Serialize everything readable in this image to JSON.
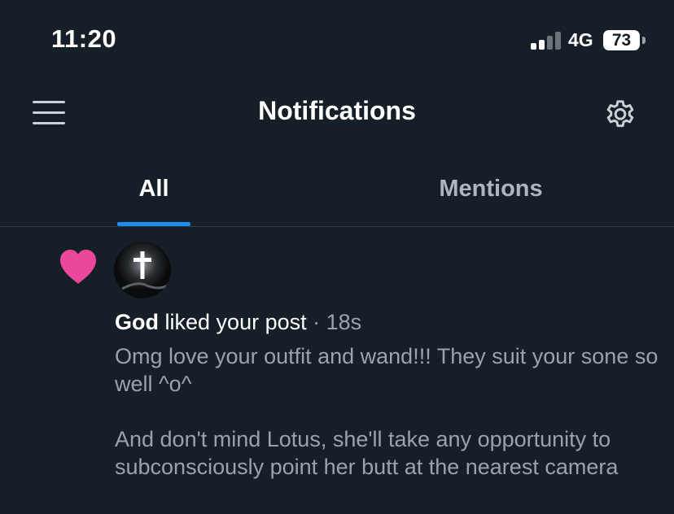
{
  "status_bar": {
    "time": "11:20",
    "network": "4G",
    "battery": "73"
  },
  "header": {
    "title": "Notifications"
  },
  "tabs": [
    {
      "label": "All",
      "active": true
    },
    {
      "label": "Mentions",
      "active": false
    }
  ],
  "colors": {
    "background": "#161e27",
    "accent": "#1d8cf0",
    "like": "#ec4899",
    "muted_text": "#9aa3ad"
  },
  "notifications": [
    {
      "type_icon": "heart-icon",
      "author": "God",
      "action": "liked your post",
      "separator": "·",
      "time": "18s",
      "avatar_icon": "cross-icon",
      "body_paragraphs": [
        "Omg love your outfit and wand!!! They suit your sone so well ^o^",
        "And don't mind Lotus, she'll take any opportunity to subconsciously point her butt at the nearest camera"
      ]
    }
  ]
}
